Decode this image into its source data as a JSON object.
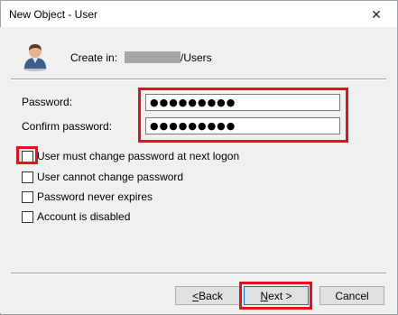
{
  "window": {
    "title": "New Object - User",
    "close_glyph": "✕"
  },
  "header": {
    "icon": "user-icon",
    "create_in_label": "Create in:",
    "create_in_path": "/Users"
  },
  "form": {
    "password_label": "Password:",
    "password_value": "●●●●●●●●●",
    "confirm_label": "Confirm password:",
    "confirm_value": "●●●●●●●●●"
  },
  "options": [
    {
      "label": "User must change password at next logon",
      "checked": false
    },
    {
      "label": "User cannot change password",
      "checked": false
    },
    {
      "label": "Password never expires",
      "checked": false
    },
    {
      "label": "Account is disabled",
      "checked": false
    }
  ],
  "buttons": {
    "back": {
      "accel": "<",
      "rest": " Back"
    },
    "next": {
      "accel": "N",
      "rest": "ext >"
    },
    "cancel": "Cancel"
  },
  "colors": {
    "highlight": "#e8101c",
    "dialog_bg": "#f0f0f0",
    "primary_border": "#0078d7"
  }
}
